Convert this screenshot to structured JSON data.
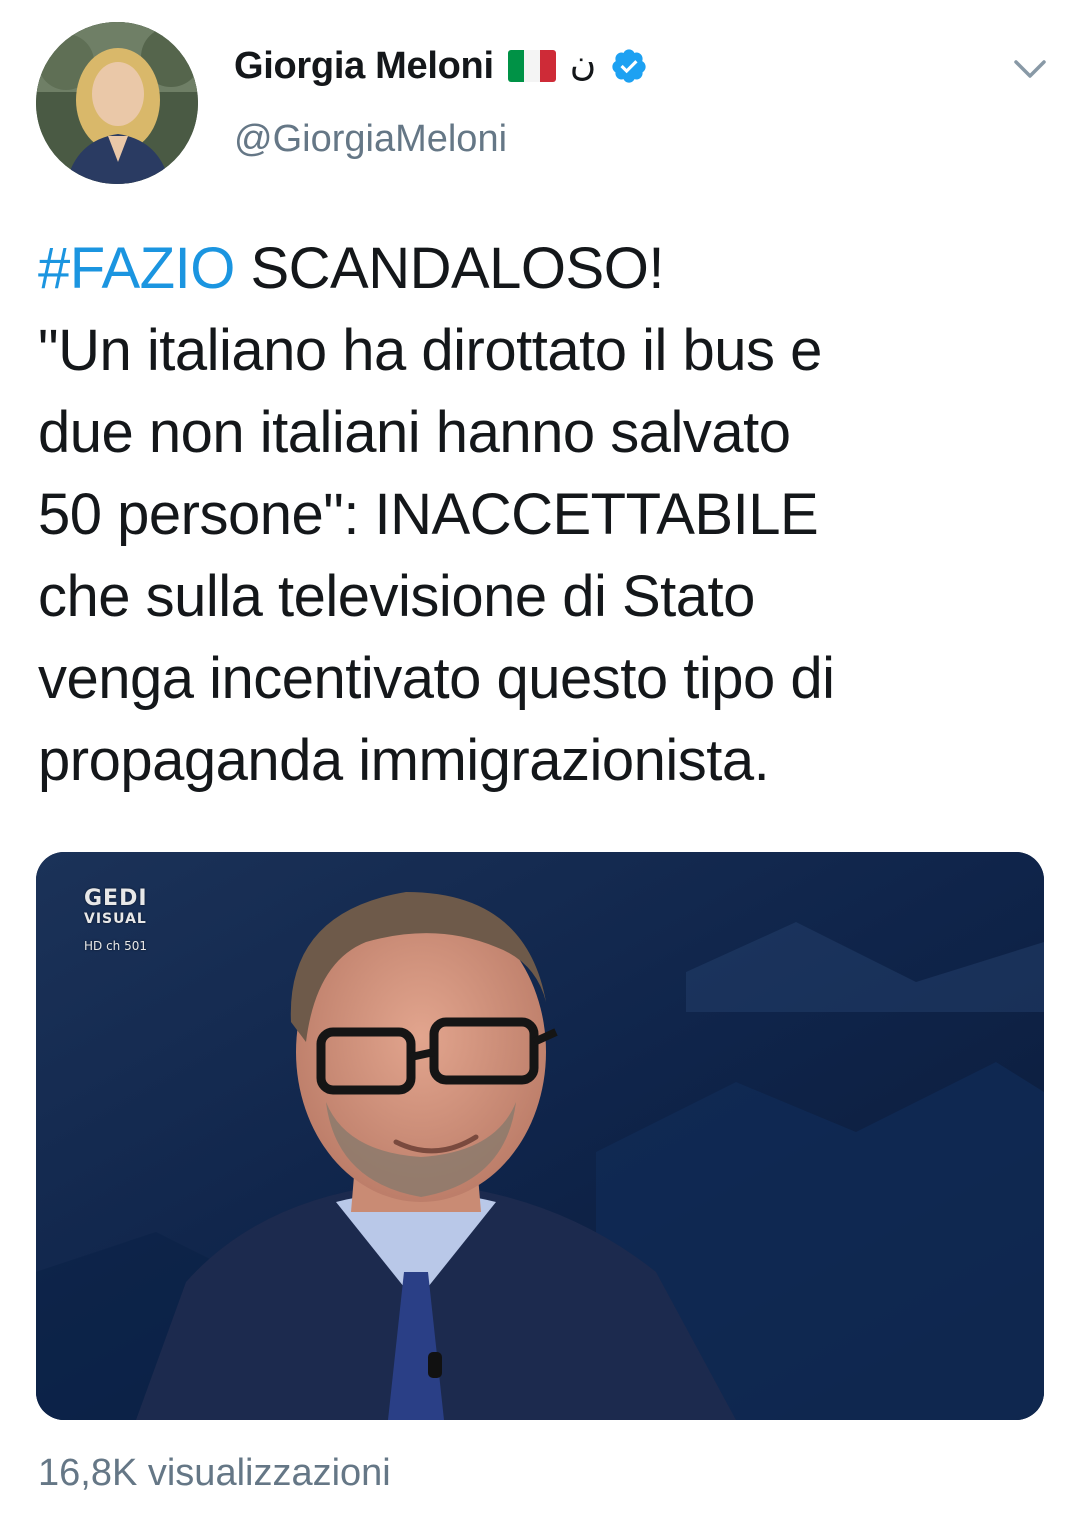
{
  "author": {
    "display_name": "Giorgia Meloni",
    "name_glyph": "ن",
    "handle": "@GiorgiaMeloni",
    "avatar_icon": "profile-photo",
    "verified_icon": "verified-badge-icon",
    "flag_icon": "italy-flag-icon",
    "flag_colors": [
      "#009246",
      "#ffffff",
      "#ce2b37"
    ]
  },
  "menu": {
    "icon": "chevron-down-icon"
  },
  "tweet": {
    "hashtag": "#FAZIO",
    "lines": [
      " SCANDALOSO!",
      "\"Un italiano ha dirottato il bus e",
      "due non italiani hanno salvato",
      "50 persone\": INACCETTABILE",
      "che sulla televisione di Stato",
      "venga incentivato questo tipo di",
      "propaganda immigrazionista."
    ]
  },
  "media": {
    "type": "video-thumbnail",
    "channel_logo_line1": "GEDI",
    "channel_logo_line2": "VISUAL",
    "channel_logo_line3": "HD ch 501"
  },
  "stats": {
    "views": "16,8K visualizzazioni"
  },
  "colors": {
    "link": "#1b95e0",
    "secondary_text": "#657786",
    "primary_text": "#14171a",
    "verified": "#1da1f2"
  }
}
